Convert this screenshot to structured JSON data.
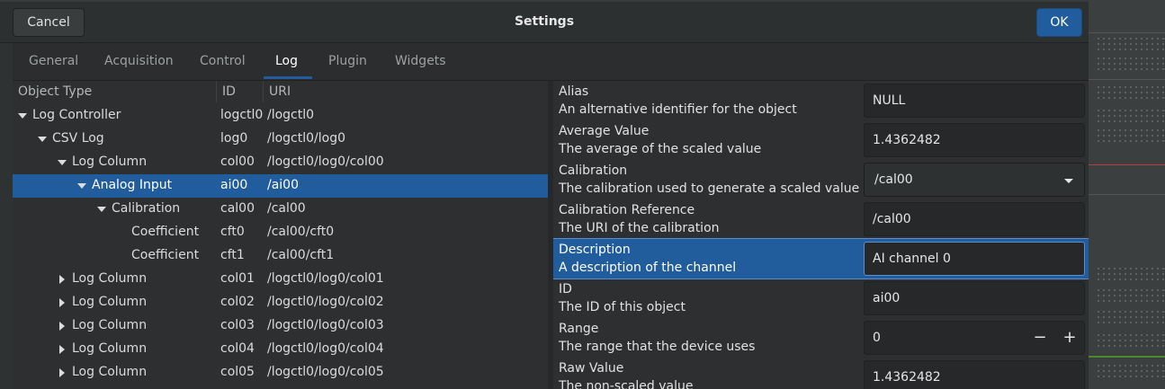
{
  "header": {
    "title": "Settings",
    "cancel_label": "Cancel",
    "ok_label": "OK"
  },
  "tabs": [
    {
      "label": "General"
    },
    {
      "label": "Acquisition"
    },
    {
      "label": "Control"
    },
    {
      "label": "Log"
    },
    {
      "label": "Plugin"
    },
    {
      "label": "Widgets"
    }
  ],
  "active_tab": "Log",
  "tree": {
    "columns": [
      "Object Type",
      "ID",
      "URI"
    ],
    "rows": [
      {
        "type": "Log Controller",
        "id": "logctl0",
        "uri": "/logctl0",
        "expander": "expanded"
      },
      {
        "type": "CSV Log",
        "id": "log0",
        "uri": "/logctl0/log0",
        "expander": "expanded"
      },
      {
        "type": "Log Column",
        "id": "col00",
        "uri": "/logctl0/log0/col00",
        "expander": "expanded"
      },
      {
        "type": "Analog Input",
        "id": "ai00",
        "uri": "/ai00",
        "expander": "expanded",
        "selected": true
      },
      {
        "type": "Calibration",
        "id": "cal00",
        "uri": "/cal00",
        "expander": "expanded"
      },
      {
        "type": "Coefficient",
        "id": "cft0",
        "uri": "/cal00/cft0",
        "expander": "none"
      },
      {
        "type": "Coefficient",
        "id": "cft1",
        "uri": "/cal00/cft1",
        "expander": "none"
      },
      {
        "type": "Log Column",
        "id": "col01",
        "uri": "/logctl0/log0/col01",
        "expander": "collapsed"
      },
      {
        "type": "Log Column",
        "id": "col02",
        "uri": "/logctl0/log0/col02",
        "expander": "collapsed"
      },
      {
        "type": "Log Column",
        "id": "col03",
        "uri": "/logctl0/log0/col03",
        "expander": "collapsed"
      },
      {
        "type": "Log Column",
        "id": "col04",
        "uri": "/logctl0/log0/col04",
        "expander": "collapsed"
      },
      {
        "type": "Log Column",
        "id": "col05",
        "uri": "/logctl0/log0/col05",
        "expander": "collapsed"
      }
    ]
  },
  "properties": [
    {
      "name": "Alias",
      "desc": "An alternative identifier for the object",
      "value": "NULL",
      "widget": "text"
    },
    {
      "name": "Average Value",
      "desc": "The average of the scaled value",
      "value": "1.4362482",
      "widget": "text"
    },
    {
      "name": "Calibration",
      "desc": "The calibration used to generate a scaled value",
      "value": "/cal00",
      "widget": "combo"
    },
    {
      "name": "Calibration Reference",
      "desc": "The URI of the calibration",
      "value": "/cal00",
      "widget": "text"
    },
    {
      "name": "Description",
      "desc": "A description of the channel",
      "value": "AI channel 0",
      "widget": "text",
      "selected": true
    },
    {
      "name": "ID",
      "desc": "The ID of this object",
      "value": "ai00",
      "widget": "text"
    },
    {
      "name": "Range",
      "desc": "The range that the device uses",
      "value": "0",
      "widget": "spin",
      "minus": "−",
      "plus": "+"
    },
    {
      "name": "Raw Value",
      "desc": "The non-scaled value",
      "value": "1.4362482",
      "widget": "text"
    }
  ],
  "colors": {
    "accent": "#215d9c",
    "background": "#2f3233"
  }
}
